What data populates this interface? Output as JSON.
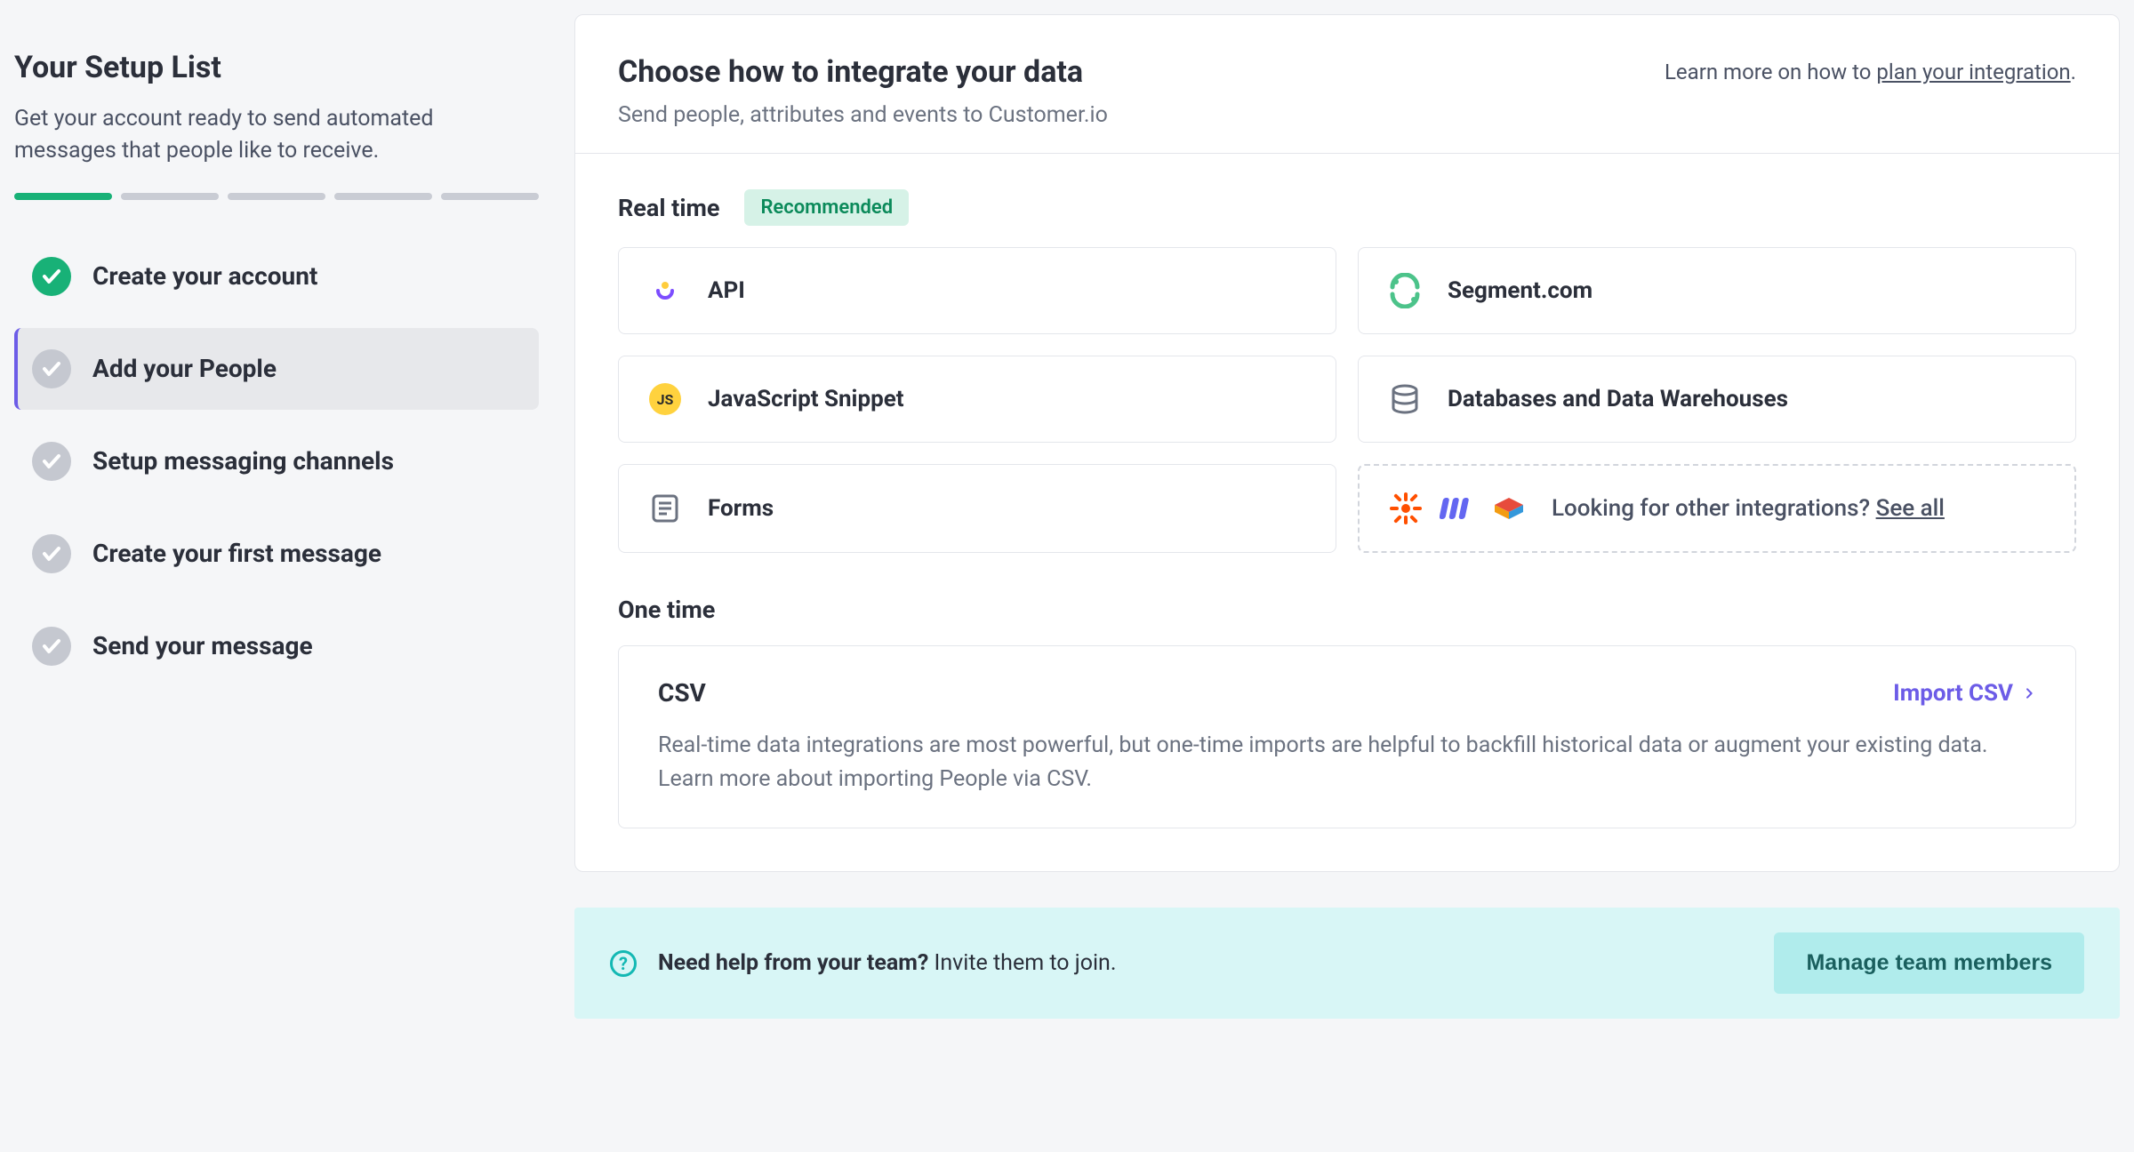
{
  "sidebar": {
    "title": "Your Setup List",
    "subtitle": "Get your account ready to send automated messages that people like to receive.",
    "progress_total": 5,
    "progress_done": 1,
    "steps": [
      {
        "label": "Create your account",
        "done": true,
        "active": false
      },
      {
        "label": "Add your People",
        "done": false,
        "active": true
      },
      {
        "label": "Setup messaging channels",
        "done": false,
        "active": false
      },
      {
        "label": "Create your first message",
        "done": false,
        "active": false
      },
      {
        "label": "Send your message",
        "done": false,
        "active": false
      }
    ]
  },
  "main": {
    "title": "Choose how to integrate your data",
    "subtitle": "Send people, attributes and events to Customer.io",
    "learn_prefix": "Learn more on how to ",
    "learn_link": "plan your integration",
    "learn_suffix": ".",
    "realtime": {
      "heading": "Real time",
      "badge": "Recommended",
      "tiles": {
        "api": "API",
        "segment": "Segment.com",
        "js": "JavaScript Snippet",
        "db": "Databases and Data Warehouses",
        "forms": "Forms"
      },
      "other_prefix": "Looking for other integrations? ",
      "other_link": "See all"
    },
    "onetime": {
      "heading": "One time",
      "title": "CSV",
      "import_label": "Import CSV",
      "desc": "Real-time data integrations are most powerful, but one-time imports are helpful to backfill historical data or augment your existing data. Learn more about importing People via CSV."
    }
  },
  "team": {
    "strong": "Need help from your team?",
    "rest": " Invite them to join.",
    "button": "Manage team members"
  }
}
